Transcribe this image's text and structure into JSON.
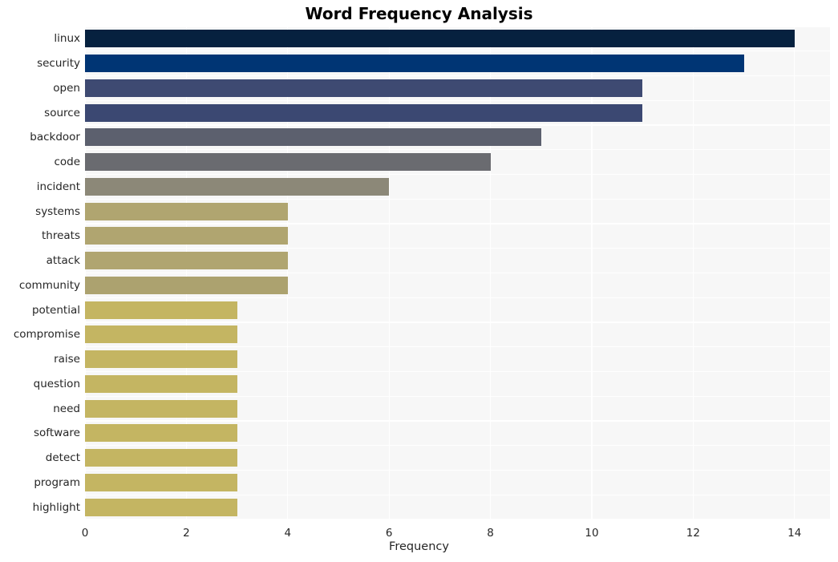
{
  "chart_data": {
    "type": "bar",
    "orientation": "horizontal",
    "title": "Word Frequency Analysis",
    "xlabel": "Frequency",
    "ylabel": "",
    "xlim": [
      0,
      14.7
    ],
    "ylim": [
      0,
      20
    ],
    "grid": true,
    "legend": null,
    "xticks": [
      0,
      2,
      4,
      6,
      8,
      10,
      12,
      14
    ],
    "xtick_labels": [
      "0",
      "2",
      "4",
      "6",
      "8",
      "10",
      "12",
      "14"
    ],
    "categories": [
      "linux",
      "security",
      "open",
      "source",
      "backdoor",
      "code",
      "incident",
      "systems",
      "threats",
      "attack",
      "community",
      "potential",
      "compromise",
      "raise",
      "question",
      "need",
      "software",
      "detect",
      "program",
      "highlight"
    ],
    "values": [
      14,
      13,
      11,
      11,
      9,
      8,
      6,
      4,
      4,
      4,
      4,
      3,
      3,
      3,
      3,
      3,
      3,
      3,
      3,
      3
    ],
    "bar_colors": [
      "#06213f",
      "#003574",
      "#3e4a72",
      "#3b4872",
      "#5c606e",
      "#6a6b70",
      "#8c8878",
      "#b0a570",
      "#b0a570",
      "#b0a570",
      "#aca26f",
      "#c4b562",
      "#c4b562",
      "#c4b562",
      "#c4b562",
      "#c4b562",
      "#c4b562",
      "#c4b562",
      "#c4b562",
      "#c4b562"
    ],
    "plot_background": "#f7f7f7",
    "grid_color": "#ffffff",
    "figure_background": "#ffffff",
    "text_color": "#262626"
  }
}
